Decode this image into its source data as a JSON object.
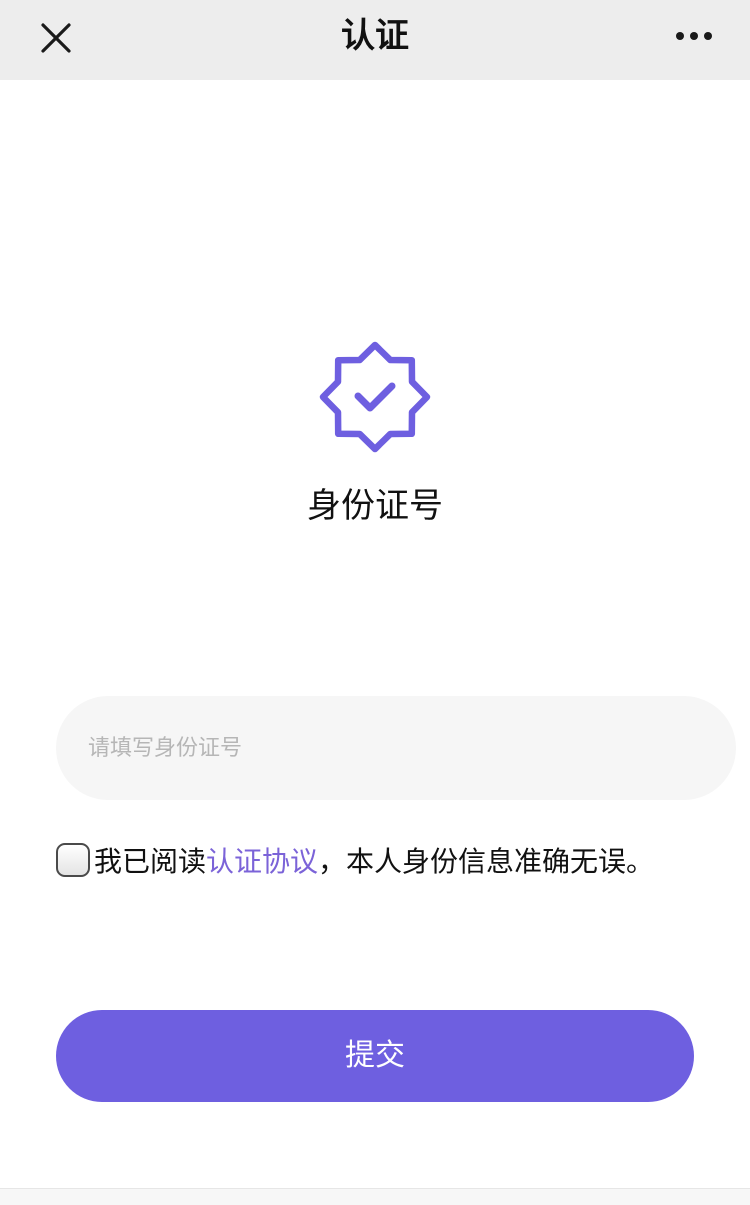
{
  "navbar": {
    "title": "认证",
    "close_icon": "close-icon",
    "more_icon": "more-horizontal-icon",
    "background": "#ededed"
  },
  "hero": {
    "icon": "verified-badge-icon",
    "icon_color": "#6e5fe0",
    "title": "身份证号"
  },
  "form": {
    "id_input": {
      "placeholder": "请填写身份证号",
      "value": ""
    },
    "agreement": {
      "checked": false,
      "prefix": "我已阅读",
      "link_label": "认证协议",
      "suffix": "，本人身份信息准确无误。",
      "link_color": "#7b63d8"
    },
    "submit_label": "提交",
    "submit_color": "#6e5fe0"
  }
}
